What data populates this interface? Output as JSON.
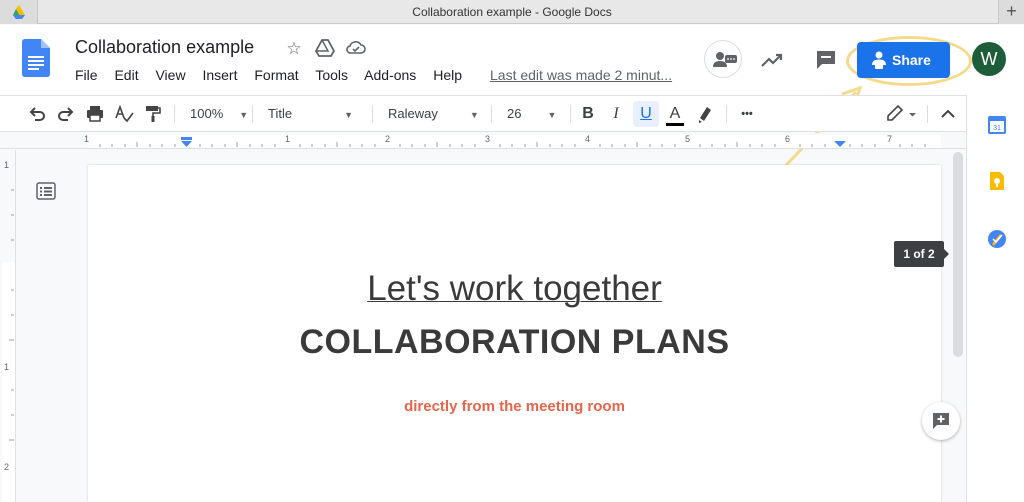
{
  "window": {
    "title": "Collaboration example - Google Docs"
  },
  "doc": {
    "title": "Collaboration example",
    "menu": [
      "File",
      "Edit",
      "View",
      "Insert",
      "Format",
      "Tools",
      "Add-ons",
      "Help"
    ],
    "last_edit": "Last edit was made 2 minut..."
  },
  "header": {
    "share_label": "Share",
    "user_initial": "W"
  },
  "toolbar": {
    "zoom": "100%",
    "style": "Title",
    "font": "Raleway",
    "size": "26",
    "more": "•••"
  },
  "ruler": {
    "top_marks": [
      "1",
      "1",
      "2",
      "3",
      "4",
      "5",
      "6",
      "7"
    ],
    "side_marks": [
      "1",
      "1",
      "2"
    ]
  },
  "content": {
    "line1": "Let's work together",
    "line2": "COLLABORATION PLANS",
    "line3": "directly from the meeting room"
  },
  "page_indicator": "1 of 2",
  "colors": {
    "share_blue": "#1a73e8",
    "highlight": "#f5da8c",
    "accent_text": "#e8644a",
    "avatar_green": "#1e5d3a"
  }
}
